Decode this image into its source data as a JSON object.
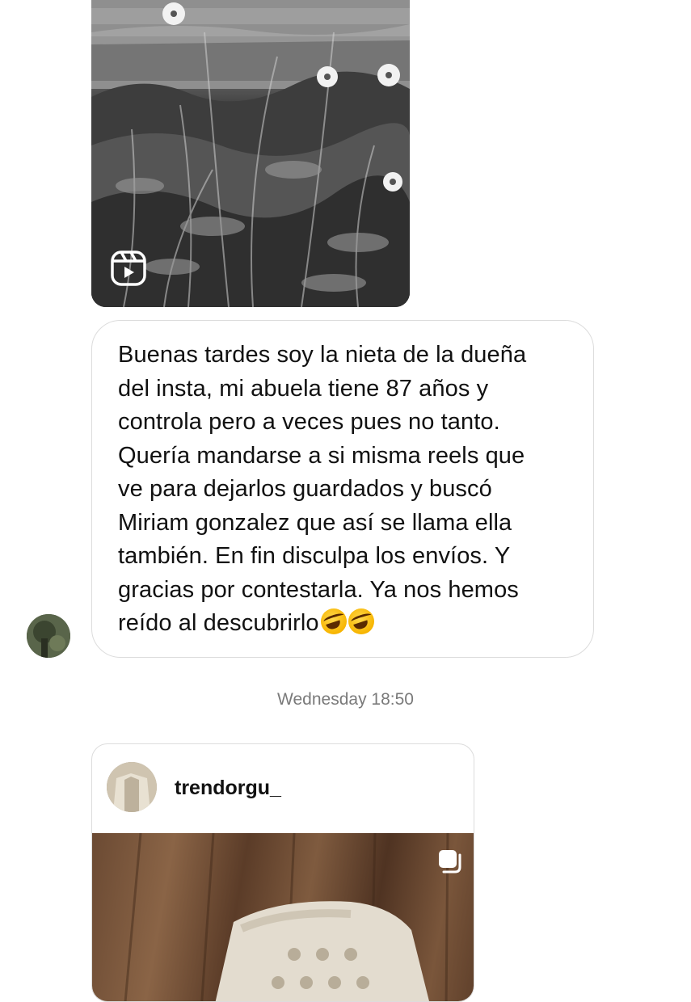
{
  "thread": {
    "reel_badge_icon": "reels-icon",
    "message": {
      "lines": [
        "Buenas tardes soy la nieta de la dueña",
        "del insta, mi abuela tiene 87 años y",
        "controla pero a veces pues no tanto.",
        "Quería mandarse a si misma reels que",
        "ve para dejarlos guardados y buscó",
        "Miriam gonzalez que así se llama ella",
        "también. En fin disculpa los envíos. Y",
        "gracias por contestarla. Ya nos hemos",
        "reído al descubrirlo"
      ],
      "emoji": [
        "🤣",
        "🤣"
      ]
    },
    "timestamp": "Wednesday 18:50",
    "shared_post": {
      "username": "trendorgu_",
      "badge_icon": "carousel-icon"
    }
  }
}
